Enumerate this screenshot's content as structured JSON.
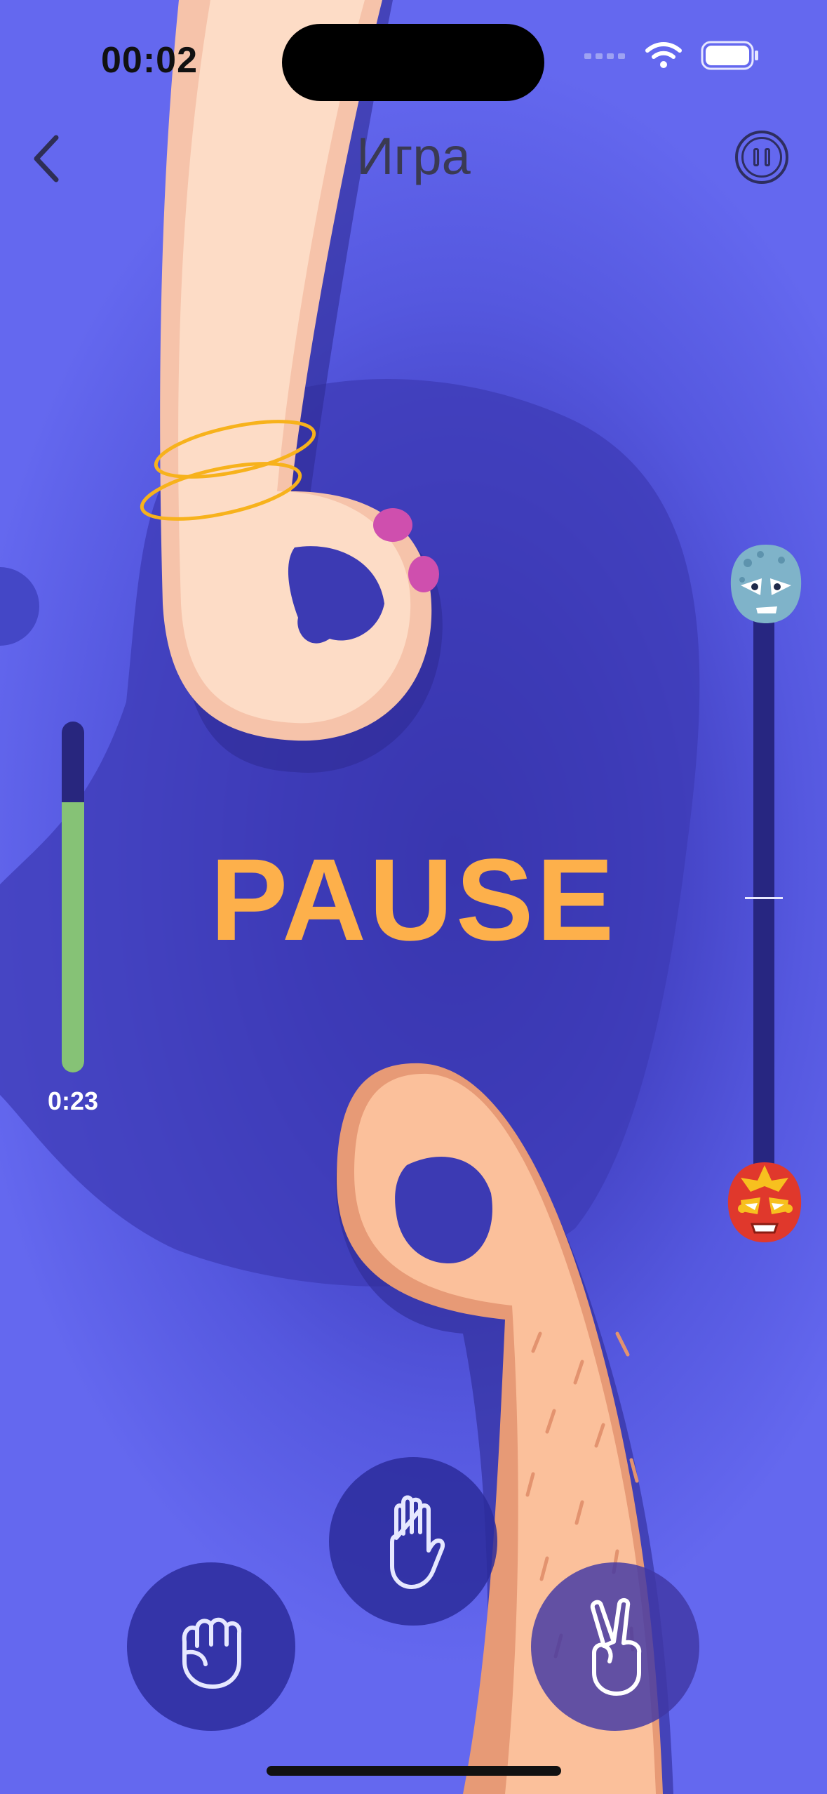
{
  "status_bar": {
    "time": "00:02"
  },
  "nav": {
    "title": "Игра"
  },
  "timer": {
    "remaining": "0:23",
    "fill_fraction": 0.77
  },
  "game": {
    "state_text": "PAUSE"
  },
  "moves": [
    {
      "name": "rock",
      "icon": "fist-icon"
    },
    {
      "name": "paper",
      "icon": "open-hand-icon"
    },
    {
      "name": "scissors",
      "icon": "victory-hand-icon"
    }
  ],
  "colors": {
    "background": "#5f63ea",
    "pause_text": "#fdb04b",
    "timer_fill": "#86c276",
    "track": "#272681"
  }
}
